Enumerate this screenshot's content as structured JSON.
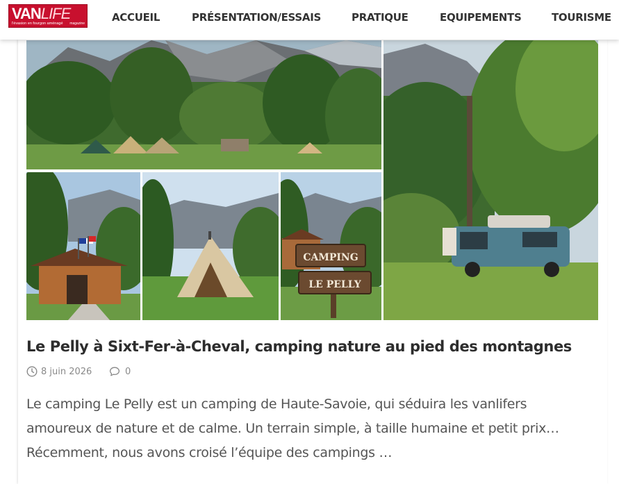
{
  "header": {
    "logo": {
      "main_left": "VAN",
      "main_right": "LIFE",
      "tagline": "l'évasion en fourgon aménagé",
      "tag_suffix": "magazine"
    },
    "nav": [
      {
        "label": "ACCUEIL"
      },
      {
        "label": "PRÉSENTATION/ESSAIS"
      },
      {
        "label": "PRATIQUE"
      },
      {
        "label": "EQUIPEMENTS"
      },
      {
        "label": "TOURISME"
      }
    ]
  },
  "article": {
    "title": "Le Pelly à Sixt-Fer-à-Cheval, camping nature au pied des montagnes",
    "date": "8 juin 2026",
    "comments": "0",
    "excerpt_lines": [
      "Le camping Le Pelly est un camping de Haute-Savoie, qui séduira les vanlifers",
      "amoureux de nature et de calme. Un terrain simple, à taille humaine et petit prix…",
      "Récemment, nous avons croisé l’équipe des campings …"
    ],
    "image": {
      "sign_line1": "CAMPING",
      "sign_line2": "LE PELLY"
    }
  },
  "colors": {
    "brand_red": "#c8102e",
    "nav_text": "#333333",
    "title_text": "#2d2d2d",
    "meta_text": "#8a8a8a",
    "body_text": "#555555"
  },
  "icons": {
    "date": "clock-icon",
    "comments": "speech-bubble-icon"
  }
}
